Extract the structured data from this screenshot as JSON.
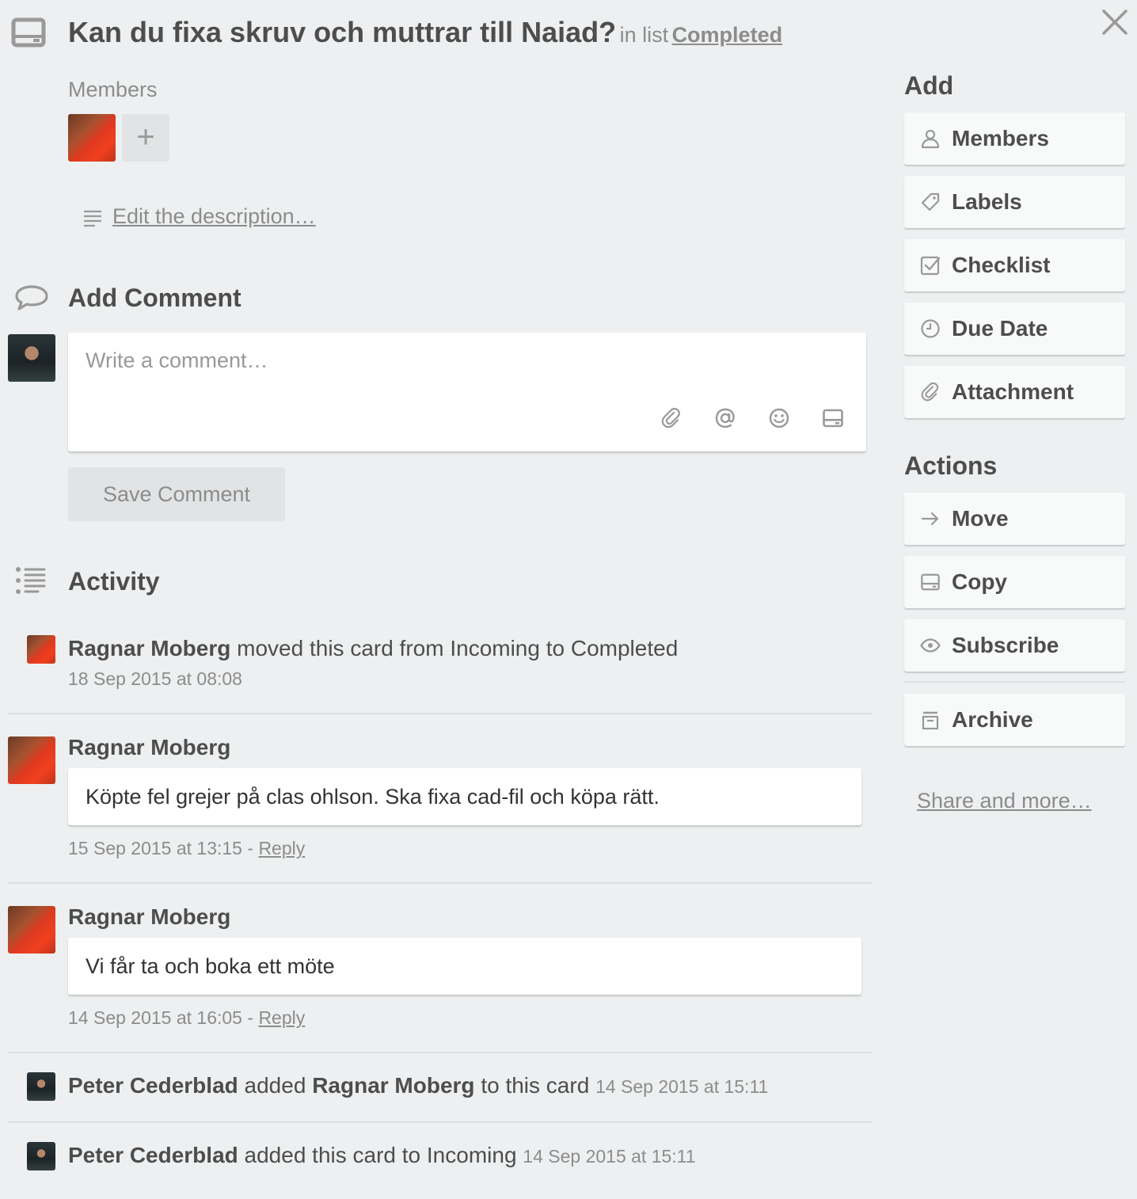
{
  "header": {
    "title": "Kan du fixa skruv och muttrar till Naiad?",
    "in_list_prefix": "in list",
    "list_name": "Completed"
  },
  "members": {
    "label": "Members",
    "add_symbol": "+"
  },
  "description": {
    "edit_link": "Edit the description…"
  },
  "add_comment": {
    "heading": "Add Comment",
    "placeholder": "Write a comment…",
    "save_label": "Save Comment",
    "tool_icons": [
      "paperclip-icon",
      "at-sign-icon",
      "emoji-icon",
      "card-icon"
    ]
  },
  "activity": {
    "heading": "Activity",
    "items": [
      {
        "author": "Ragnar Moberg",
        "action": "moved this card from Incoming to Completed",
        "timestamp": "18 Sep 2015 at 08:08"
      },
      {
        "author": "Ragnar Moberg",
        "comment": "Köpte fel grejer på clas ohlson. Ska fixa cad-fil och köpa rätt.",
        "timestamp": "15 Sep 2015 at 13:15",
        "separator": "-",
        "reply": "Reply"
      },
      {
        "author": "Ragnar Moberg",
        "comment": "Vi får ta och boka ett möte",
        "timestamp": "14 Sep 2015 at 16:05",
        "separator": "-",
        "reply": "Reply"
      },
      {
        "author": "Peter Cederblad",
        "action_pre": "added",
        "target": "Ragnar Moberg",
        "action_post": "to this card",
        "timestamp": "14 Sep 2015 at 15:11"
      },
      {
        "author": "Peter Cederblad",
        "action": "added this card to Incoming",
        "timestamp": "14 Sep 2015 at 15:11"
      }
    ]
  },
  "sidebar": {
    "add_heading": "Add",
    "add_buttons": [
      {
        "label": "Members",
        "icon": "person-icon"
      },
      {
        "label": "Labels",
        "icon": "tag-icon"
      },
      {
        "label": "Checklist",
        "icon": "checkbox-icon"
      },
      {
        "label": "Due Date",
        "icon": "clock-icon"
      },
      {
        "label": "Attachment",
        "icon": "paperclip-icon"
      }
    ],
    "actions_heading": "Actions",
    "action_buttons": [
      {
        "label": "Move",
        "icon": "arrow-right-icon"
      },
      {
        "label": "Copy",
        "icon": "card-icon"
      },
      {
        "label": "Subscribe",
        "icon": "eye-icon"
      },
      {
        "label": "Archive",
        "icon": "archive-icon"
      }
    ],
    "share_link": "Share and more…"
  },
  "colors": {
    "background": "#edeff0",
    "text": "#4d4d4d",
    "muted": "#8c8c8c",
    "button": "#f8f9f9"
  }
}
